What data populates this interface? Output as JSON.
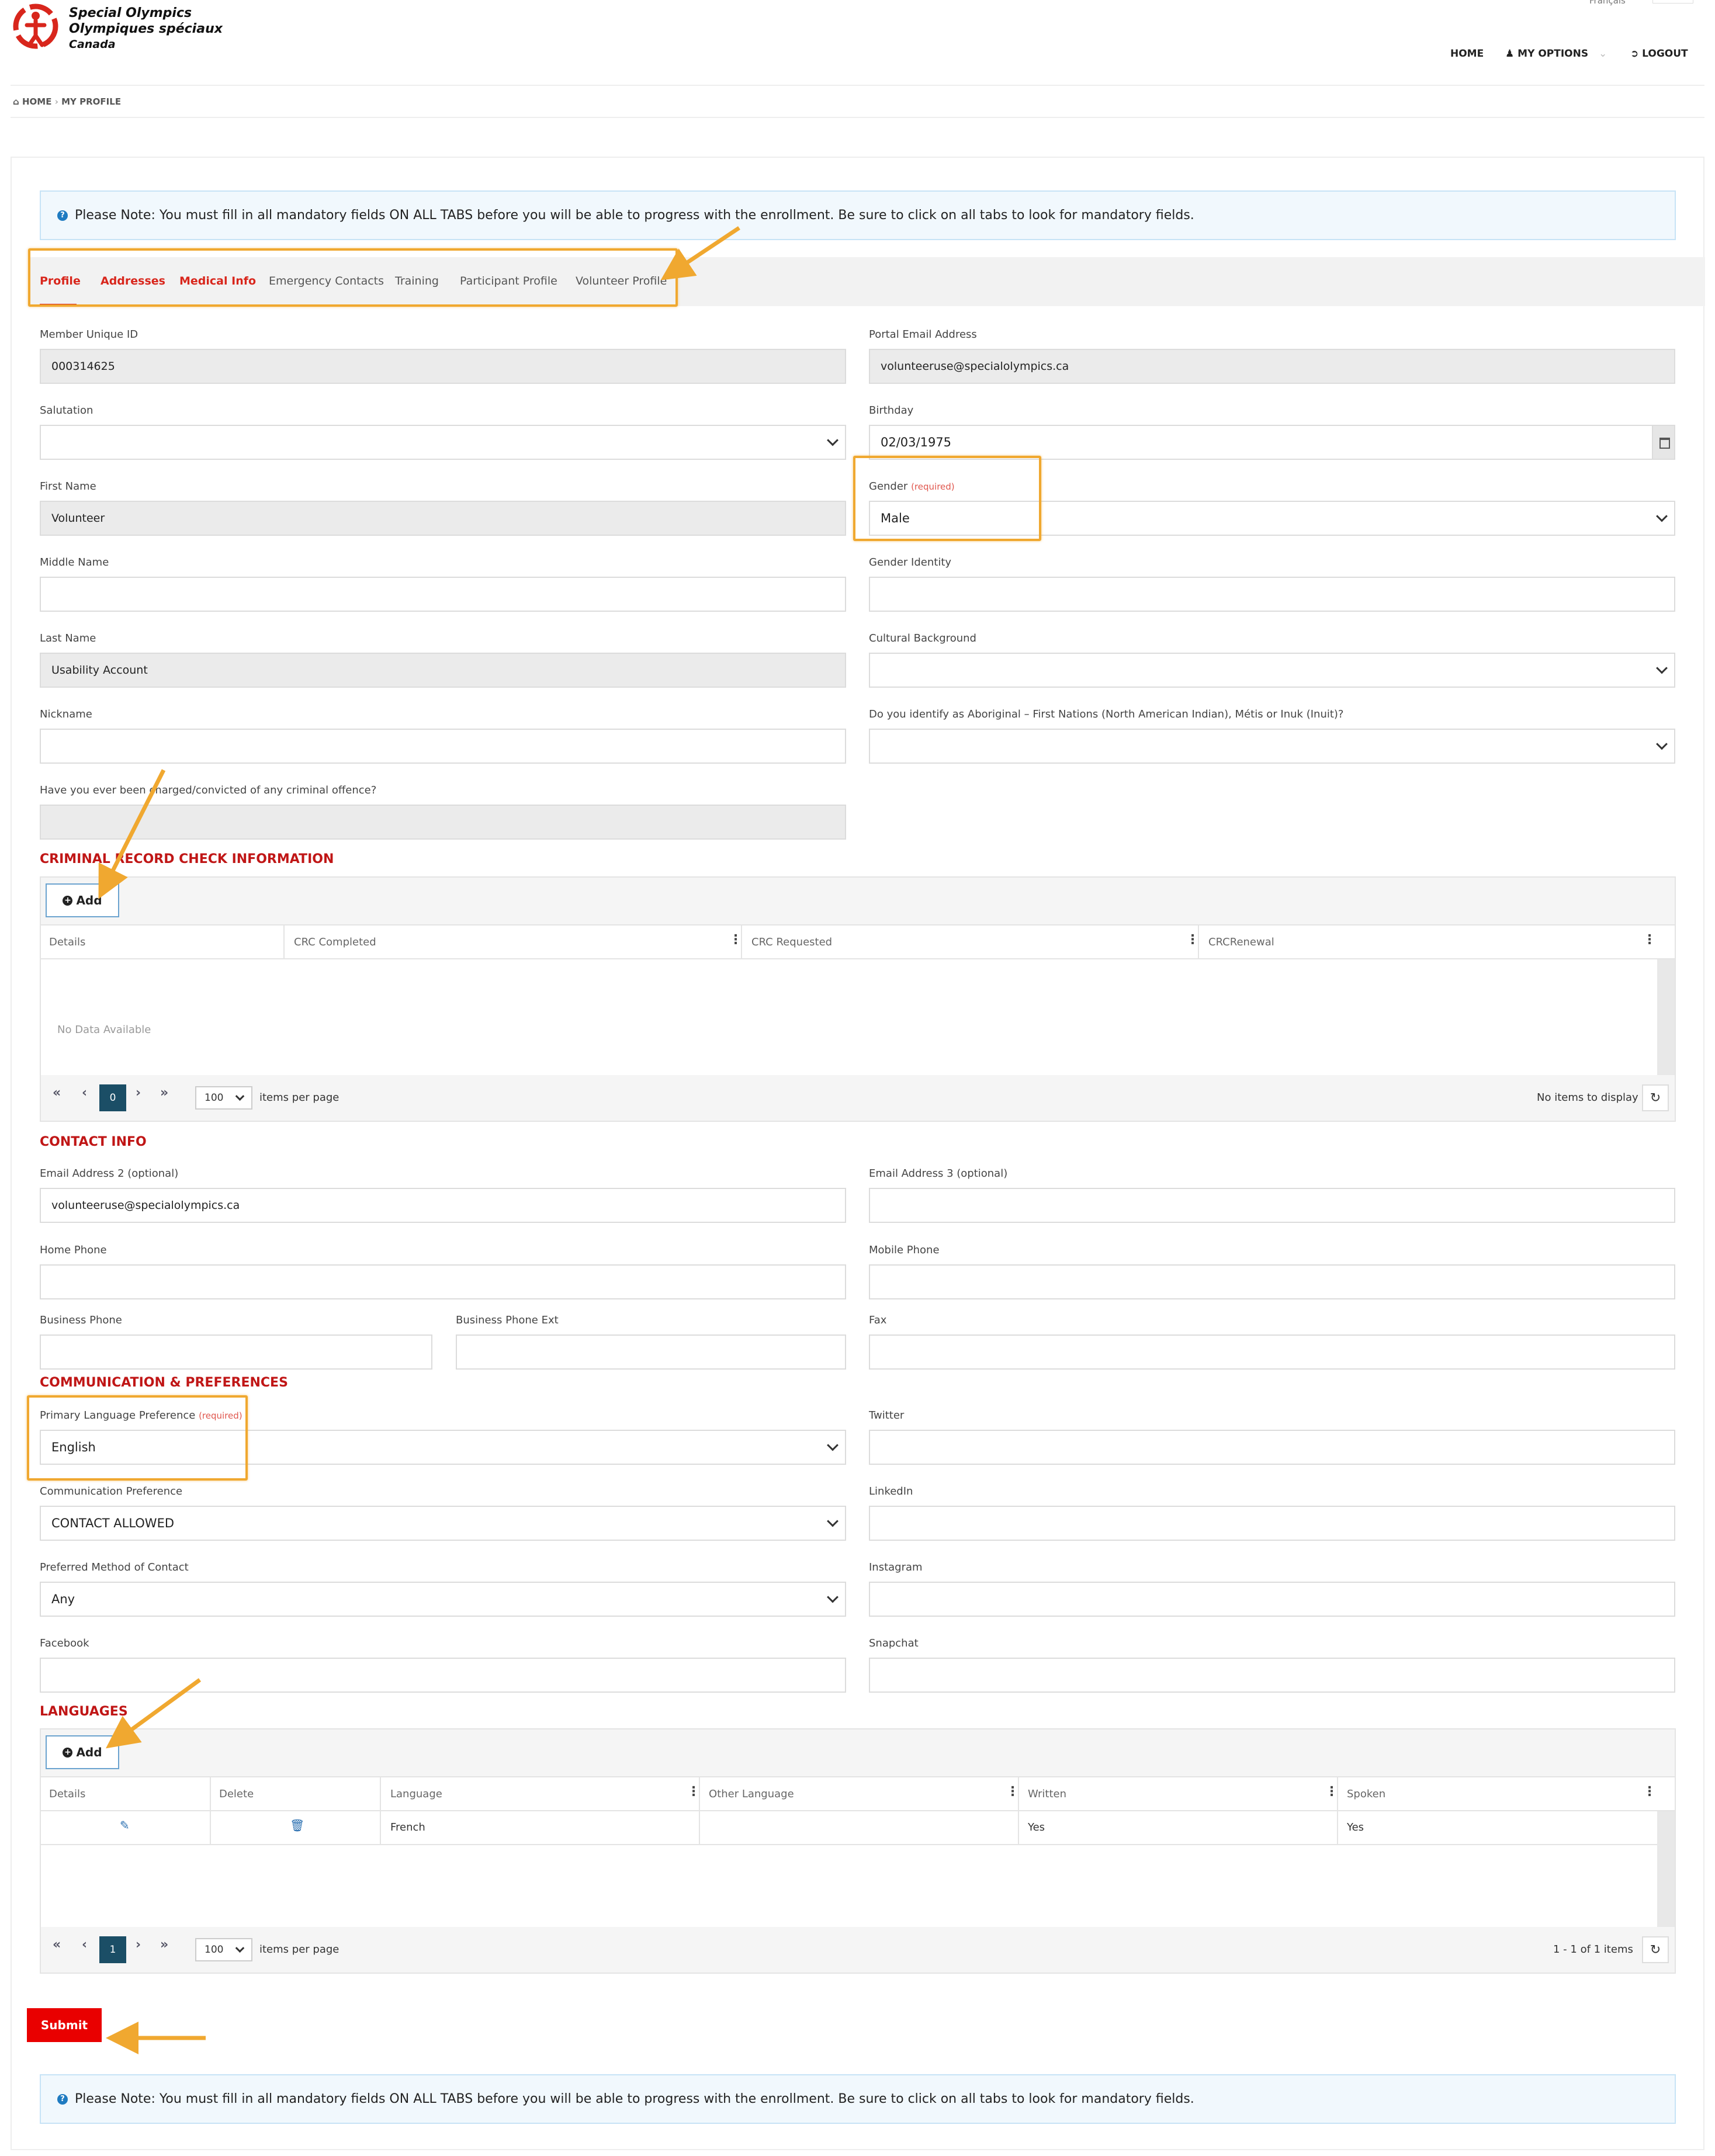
{
  "header": {
    "lang_link": "Français",
    "logo": {
      "line1": "Special Olympics",
      "line2": "Olympiques spéciaux",
      "line3": "Canada"
    },
    "nav": {
      "home": "HOME",
      "my_options": "MY OPTIONS",
      "logout": "LOGOUT"
    }
  },
  "breadcrumb": {
    "home": "HOME",
    "current": "MY PROFILE"
  },
  "note": "Please Note: You must fill in all mandatory fields ON ALL TABS before you will be able to progress with the enrollment. Be sure to click on all tabs to look for mandatory fields.",
  "tabs": [
    "Profile",
    "Addresses",
    "Medical Info",
    "Emergency Contacts",
    "Training",
    "Participant Profile",
    "Volunteer Profile"
  ],
  "profile": {
    "member_id": {
      "label": "Member Unique ID",
      "value": "000314625"
    },
    "portal_email": {
      "label": "Portal Email Address",
      "value": "volunteeruse@specialolympics.ca"
    },
    "salutation": {
      "label": "Salutation",
      "value": ""
    },
    "birthday": {
      "label": "Birthday",
      "value": "02/03/1975"
    },
    "first_name": {
      "label": "First Name",
      "value": "Volunteer"
    },
    "gender": {
      "label": "Gender",
      "required": "(required)",
      "value": "Male"
    },
    "middle_name": {
      "label": "Middle Name",
      "value": ""
    },
    "gender_identity": {
      "label": "Gender Identity",
      "value": ""
    },
    "last_name": {
      "label": "Last Name",
      "value": "Usability Account"
    },
    "cultural_background": {
      "label": "Cultural Background",
      "value": ""
    },
    "nickname": {
      "label": "Nickname",
      "value": ""
    },
    "aboriginal": {
      "label": "Do you identify as Aboriginal – First Nations (North American Indian), Métis or Inuk (Inuit)?",
      "value": ""
    },
    "criminal": {
      "label": "Have you ever been charged/convicted of any criminal offence?",
      "value": ""
    }
  },
  "crc": {
    "title": "CRIMINAL RECORD CHECK INFORMATION",
    "add": "Add",
    "columns": [
      "Details",
      "CRC Completed",
      "CRC Requested",
      "CRCRenewal"
    ],
    "empty": "No Data Available",
    "pager": {
      "page": "0",
      "per_page": "100",
      "per_page_label": "items per page",
      "status": "No items to display"
    }
  },
  "contact": {
    "title": "CONTACT INFO",
    "email2": {
      "label": "Email Address 2 (optional)",
      "value": "volunteeruse@specialolympics.ca"
    },
    "email3": {
      "label": "Email Address 3 (optional)",
      "value": ""
    },
    "home_phone": {
      "label": "Home Phone",
      "value": ""
    },
    "mobile_phone": {
      "label": "Mobile Phone",
      "value": ""
    },
    "business_phone": {
      "label": "Business Phone",
      "value": ""
    },
    "business_ext": {
      "label": "Business Phone Ext",
      "value": ""
    },
    "fax": {
      "label": "Fax",
      "value": ""
    }
  },
  "comm": {
    "title": "COMMUNICATION & PREFERENCES",
    "primary_language": {
      "label": "Primary Language Preference",
      "required": "(required)",
      "value": "English"
    },
    "twitter": {
      "label": "Twitter",
      "value": ""
    },
    "comm_pref": {
      "label": "Communication Preference",
      "value": "CONTACT ALLOWED"
    },
    "linkedin": {
      "label": "LinkedIn",
      "value": ""
    },
    "method": {
      "label": "Preferred Method of Contact",
      "value": "Any"
    },
    "instagram": {
      "label": "Instagram",
      "value": ""
    },
    "facebook": {
      "label": "Facebook",
      "value": ""
    },
    "snapchat": {
      "label": "Snapchat",
      "value": ""
    }
  },
  "languages": {
    "title": "LANGUAGES",
    "add": "Add",
    "columns": [
      "Details",
      "Delete",
      "Language",
      "Other Language",
      "Written",
      "Spoken"
    ],
    "rows": [
      {
        "language": "French",
        "other": "",
        "written": "Yes",
        "spoken": "Yes"
      }
    ],
    "pager": {
      "page": "1",
      "per_page": "100",
      "per_page_label": "items per page",
      "status": "1 - 1 of 1 items"
    }
  },
  "submit": "Submit",
  "colors": {
    "brand_red": "#d8261c",
    "section_red": "#c01616",
    "submit_red": "#e90000",
    "highlight": "#f0a830",
    "pager_active": "#1b4e66"
  }
}
